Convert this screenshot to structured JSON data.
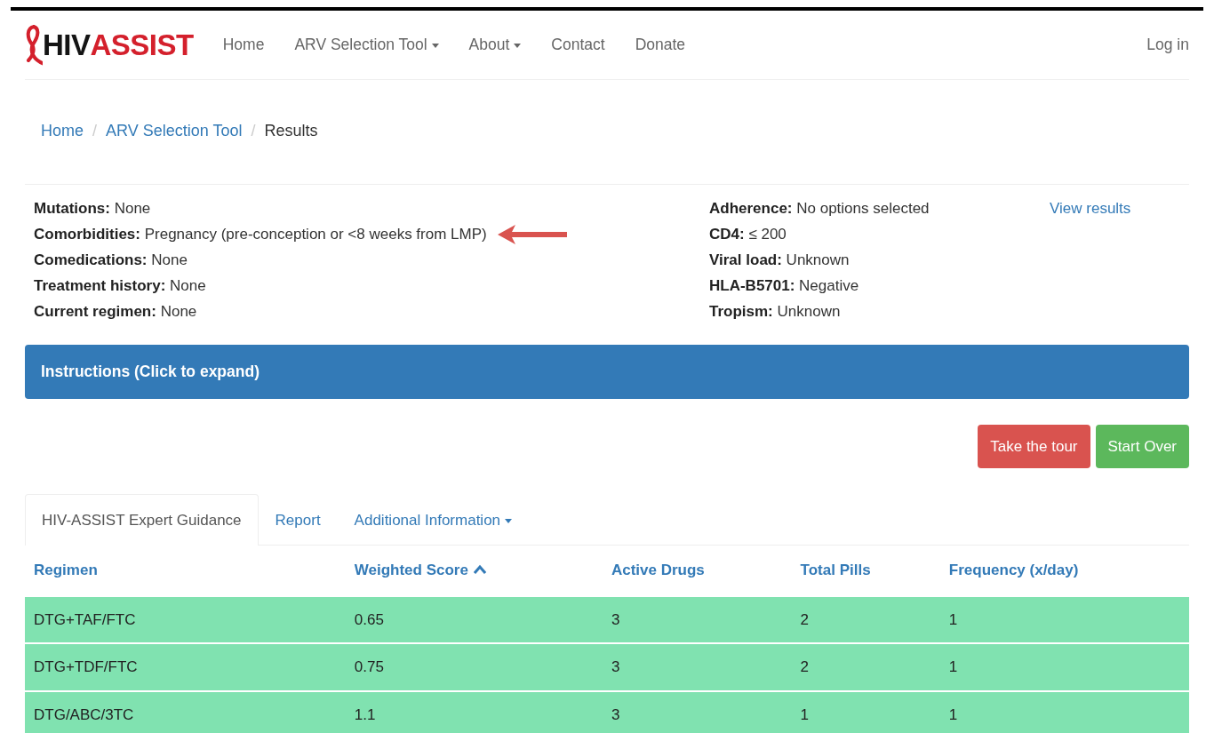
{
  "brand": [
    {
      "text": "HIV",
      "color": "#141414"
    },
    {
      "text": "ASSIST",
      "color": "#d4202c"
    }
  ],
  "nav": [
    {
      "label": "Home",
      "dropdown": false
    },
    {
      "label": "ARV Selection Tool",
      "dropdown": true
    },
    {
      "label": "About",
      "dropdown": true
    },
    {
      "label": "Contact",
      "dropdown": false
    },
    {
      "label": "Donate",
      "dropdown": false
    }
  ],
  "login": "Log in",
  "breadcrumb": [
    {
      "label": "Home",
      "link": true
    },
    {
      "separator_before": "/",
      "label": "ARV Selection Tool",
      "link": true
    },
    {
      "separator_before": "/",
      "label": "Results",
      "link": false
    }
  ],
  "summary_left": [
    {
      "label": "Mutations:",
      "value": "None",
      "arrow": false
    },
    {
      "label": "Comorbidities:",
      "value": "Pregnancy (pre-conception or <8 weeks from LMP)",
      "arrow": true
    },
    {
      "label": "Comedications:",
      "value": "None",
      "arrow": false
    },
    {
      "label": "Treatment history:",
      "value": "None",
      "arrow": false
    },
    {
      "label": "Current regimen:",
      "value": "None",
      "arrow": false
    }
  ],
  "summary_right": [
    {
      "label": "Adherence:",
      "value": "No options selected"
    },
    {
      "label": "CD4:",
      "value": "≤ 200"
    },
    {
      "label": "Viral load:",
      "value": "Unknown"
    },
    {
      "label": "HLA-B5701:",
      "value": "Negative"
    },
    {
      "label": "Tropism:",
      "value": "Unknown"
    }
  ],
  "view_results": "View results",
  "instructions": {
    "title": "Instructions (Click to expand)",
    "expanded": false
  },
  "buttons": [
    {
      "label": "Take the tour",
      "kind": "danger"
    },
    {
      "label": "Start Over",
      "kind": "success"
    }
  ],
  "tabs": [
    {
      "label": "HIV-ASSIST Expert Guidance",
      "selected": true,
      "dropdown": false
    },
    {
      "label": "Report",
      "selected": false,
      "dropdown": false
    },
    {
      "label": "Additional Information",
      "selected": false,
      "dropdown": true
    }
  ],
  "table": {
    "columns": [
      {
        "label": "Regimen",
        "sorted": false
      },
      {
        "label": "Weighted Score",
        "sorted": true
      },
      {
        "label": "Active Drugs",
        "sorted": false
      },
      {
        "label": "Total Pills",
        "sorted": false
      },
      {
        "label": "Frequency (x/day)",
        "sorted": false
      }
    ],
    "rows": [
      [
        "DTG+TAF/FTC",
        "0.65",
        "3",
        "2",
        "1"
      ],
      [
        "DTG+TDF/FTC",
        "0.75",
        "3",
        "2",
        "1"
      ],
      [
        "DTG/ABC/3TC",
        "1.1",
        "3",
        "1",
        "1"
      ]
    ]
  }
}
